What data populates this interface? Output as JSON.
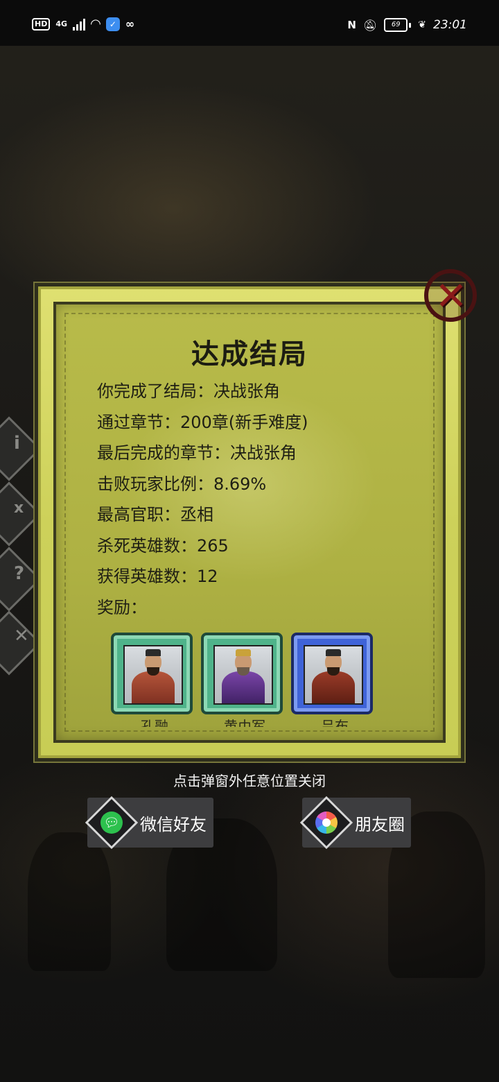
{
  "status_bar": {
    "hd": "HD",
    "network": "4G",
    "time": "23:01",
    "battery": "69"
  },
  "modal": {
    "title": "达成结局",
    "lines": [
      {
        "text": "你完成了结局：决战张角"
      },
      {
        "text": "通过章节：200章(新手难度)"
      },
      {
        "text": "最后完成的章节：决战张角"
      },
      {
        "text": "击败玩家比例：8.69%"
      },
      {
        "text": "最高官职：丞相"
      },
      {
        "text": "杀死英雄数：265"
      },
      {
        "text": "获得英雄数：12"
      },
      {
        "text": "奖励："
      }
    ],
    "rewards": [
      {
        "name": "孔融",
        "rarity": "green"
      },
      {
        "name": "黄巾军",
        "rarity": "green"
      },
      {
        "name": "吕布",
        "rarity": "blue"
      }
    ],
    "close_icon": "close-icon"
  },
  "footer": {
    "hint": "点击弹窗外任意位置关闭",
    "share_wechat": "微信好友",
    "share_moments": "朋友圈"
  },
  "colors": {
    "modal_bg": "#cdd15a",
    "green_frame": "#4fb38a",
    "blue_frame": "#3f63d8"
  }
}
